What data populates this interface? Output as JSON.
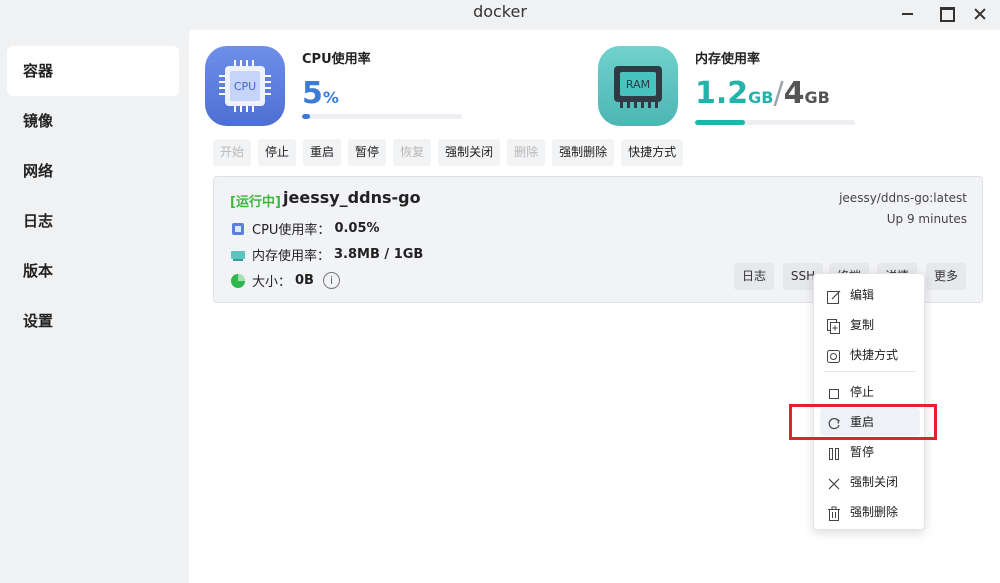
{
  "window": {
    "title": "docker"
  },
  "sidebar": {
    "items": [
      {
        "label": "容器",
        "active": true
      },
      {
        "label": "镜像"
      },
      {
        "label": "网络"
      },
      {
        "label": "日志"
      },
      {
        "label": "版本"
      },
      {
        "label": "设置"
      }
    ]
  },
  "stats": {
    "cpu": {
      "icon_text": "CPU",
      "label": "CPU使用率",
      "value": "5",
      "unit": "%",
      "fraction": 0.05,
      "color": "#3a7bd5"
    },
    "memory": {
      "icon_text": "RAM",
      "label": "内存使用率",
      "used": "1.2",
      "used_unit": "GB",
      "sep": "/",
      "total": "4",
      "total_unit": "GB",
      "fraction": 0.31,
      "color": "#24b3a8"
    }
  },
  "toolbar": {
    "buttons": [
      {
        "label": "开始",
        "disabled": true
      },
      {
        "label": "停止"
      },
      {
        "label": "重启"
      },
      {
        "label": "暂停"
      },
      {
        "label": "恢复",
        "disabled": true
      },
      {
        "label": "强制关闭"
      },
      {
        "label": "删除",
        "disabled": true
      },
      {
        "label": "强制删除"
      },
      {
        "label": "快捷方式"
      }
    ]
  },
  "container": {
    "status": "[运行中]",
    "name": "jeessy_ddns-go",
    "image": "jeessy/ddns-go:latest",
    "uptime": "Up 9 minutes",
    "cpu_label": "CPU使用率：",
    "cpu_value": "0.05%",
    "mem_label": "内存使用率：",
    "mem_value": "3.8MB / 1GB",
    "size_label": "大小：",
    "size_value": "0B",
    "info_icon": "i",
    "buttons": [
      {
        "label": "日志"
      },
      {
        "label": "SSH"
      },
      {
        "label": "终端"
      },
      {
        "label": "详情"
      },
      {
        "label": "更多"
      }
    ]
  },
  "context_menu": {
    "items": [
      {
        "label": "编辑",
        "icon": "edit-icon"
      },
      {
        "label": "复制",
        "icon": "copy-icon"
      },
      {
        "label": "快捷方式",
        "icon": "shortcut-icon"
      },
      {
        "label": "停止",
        "icon": "stop-icon"
      },
      {
        "label": "重启",
        "icon": "restart-icon",
        "highlighted": true
      },
      {
        "label": "暂停",
        "icon": "pause-icon"
      },
      {
        "label": "强制关闭",
        "icon": "close-x-icon"
      },
      {
        "label": "强制删除",
        "icon": "trash-icon"
      }
    ]
  },
  "colors": {
    "running": "#3db83d",
    "highlight_box": "#e8202a",
    "cpu_icon": "#5b7fdf",
    "ram_icon": "#5cc4c0"
  }
}
